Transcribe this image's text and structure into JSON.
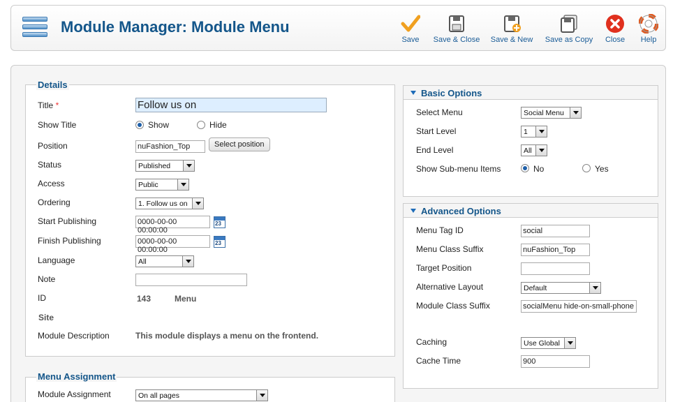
{
  "header": {
    "title": "Module Manager: Module Menu",
    "icon": "module-menu-icon"
  },
  "toolbar": {
    "save": "Save",
    "save_close": "Save & Close",
    "save_new": "Save & New",
    "save_copy": "Save as Copy",
    "close": "Close",
    "help": "Help"
  },
  "details": {
    "legend": "Details",
    "title_label": "Title",
    "required_mark": "*",
    "title_value": "Follow us on",
    "show_title_label": "Show Title",
    "show_label": "Show",
    "hide_label": "Hide",
    "show_title_selected": "Show",
    "position_label": "Position",
    "position_value": "nuFashion_Top",
    "select_position": "Select position",
    "status_label": "Status",
    "status_value": "Published",
    "access_label": "Access",
    "access_value": "Public",
    "ordering_label": "Ordering",
    "ordering_value": "1. Follow us on",
    "start_publishing_label": "Start Publishing",
    "start_publishing_value": "0000-00-00 00:00:00",
    "finish_publishing_label": "Finish Publishing",
    "finish_publishing_value": "0000-00-00 00:00:00",
    "calendar_day": "23",
    "language_label": "Language",
    "language_value": "All",
    "note_label": "Note",
    "note_value": "",
    "id_label": "ID",
    "id_value": "143",
    "module_type": "Menu",
    "site_label": "Site",
    "module_description_label": "Module Description",
    "module_description_value": "This module displays a menu on the frontend."
  },
  "menu_assignment": {
    "legend": "Menu Assignment",
    "module_assignment_label": "Module Assignment",
    "module_assignment_value": "On all pages"
  },
  "basic_options": {
    "title": "Basic Options",
    "select_menu_label": "Select Menu",
    "select_menu_value": "Social Menu",
    "start_level_label": "Start Level",
    "start_level_value": "1",
    "end_level_label": "End Level",
    "end_level_value": "All",
    "show_submenu_label": "Show Sub-menu Items",
    "no_label": "No",
    "yes_label": "Yes",
    "show_submenu_selected": "No"
  },
  "advanced_options": {
    "title": "Advanced Options",
    "menu_tag_id_label": "Menu Tag ID",
    "menu_tag_id_value": "social",
    "menu_class_suffix_label": "Menu Class Suffix",
    "menu_class_suffix_value": "nuFashion_Top",
    "target_position_label": "Target Position",
    "target_position_value": "",
    "alternative_layout_label": "Alternative Layout",
    "alternative_layout_value": "Default",
    "module_class_suffix_label": "Module Class Suffix",
    "module_class_suffix_value": "socialMenu hide-on-small-phone",
    "caching_label": "Caching",
    "caching_value": "Use Global",
    "cache_time_label": "Cache Time",
    "cache_time_value": "900"
  },
  "colors": {
    "title_blue": "#14568a",
    "link_blue": "#1a5c97",
    "save_orange": "#f0a020",
    "close_red": "#e0301e"
  }
}
